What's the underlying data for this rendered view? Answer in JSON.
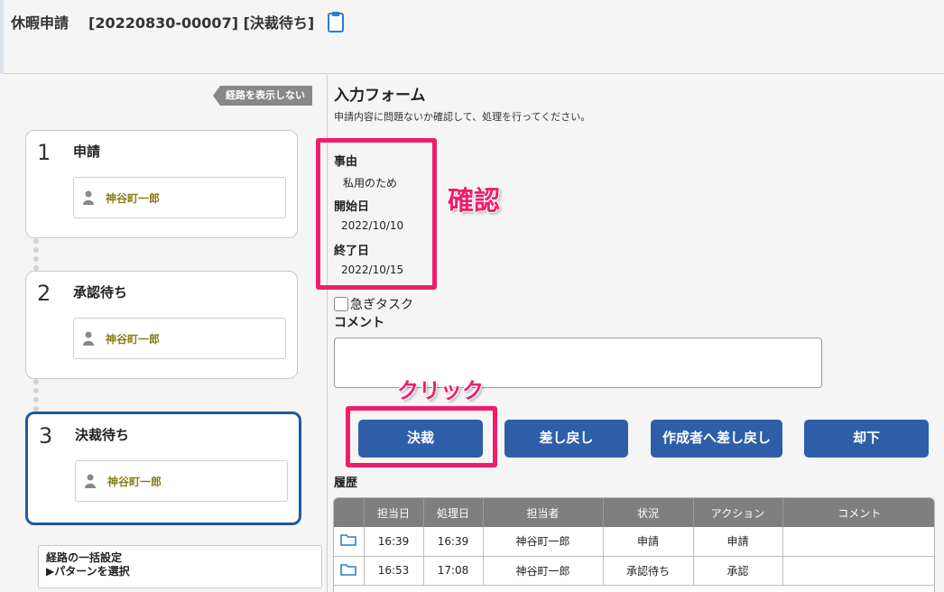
{
  "header": {
    "title": "休暇申請",
    "document_id": "[20220830-00007] [決裁待ち]",
    "icon": "clipboard-icon"
  },
  "route": {
    "toggle_label": "経路を表示しない",
    "steps": [
      {
        "number": "1",
        "name": "申請",
        "user": "神谷町一郎",
        "active": false
      },
      {
        "number": "2",
        "name": "承認待ち",
        "user": "神谷町一郎",
        "active": false
      },
      {
        "number": "3",
        "name": "決裁待ち",
        "user": "神谷町一郎",
        "active": true
      }
    ],
    "bulk_setting": {
      "line1": "経路の一括設定",
      "line2": "▶パターンを選択"
    }
  },
  "form": {
    "title": "入力フォーム",
    "description": "申請内容に問題ないか確認して、処理を行ってください。",
    "fields": [
      {
        "label": "事由",
        "value": "私用のため"
      },
      {
        "label": "開始日",
        "value": "2022/10/10"
      },
      {
        "label": "終了日",
        "value": "2022/10/15"
      }
    ],
    "urgent_label": "急ぎタスク",
    "urgent_checked": false,
    "comment_label": "コメント",
    "comment_value": ""
  },
  "annotations": {
    "confirm": "確認",
    "click": "クリック",
    "color": "#ee1e6c"
  },
  "actions": {
    "approve": "決裁",
    "send_back": "差し戻し",
    "send_back_to_creator": "作成者へ差し戻し",
    "reject": "却下",
    "button_color": "#2f5ea8"
  },
  "history": {
    "label": "履歴",
    "columns": [
      "",
      "担当日",
      "処理日",
      "担当者",
      "状況",
      "アクション",
      "コメント"
    ],
    "rows": [
      {
        "icon": "folder-icon",
        "assigned": "16:39",
        "processed": "16:39",
        "person": "神谷町一郎",
        "status": "申請",
        "action": "申請",
        "comment": ""
      },
      {
        "icon": "folder-icon",
        "assigned": "16:53",
        "processed": "17:08",
        "person": "神谷町一郎",
        "status": "承認待ち",
        "action": "承認",
        "comment": ""
      }
    ]
  }
}
